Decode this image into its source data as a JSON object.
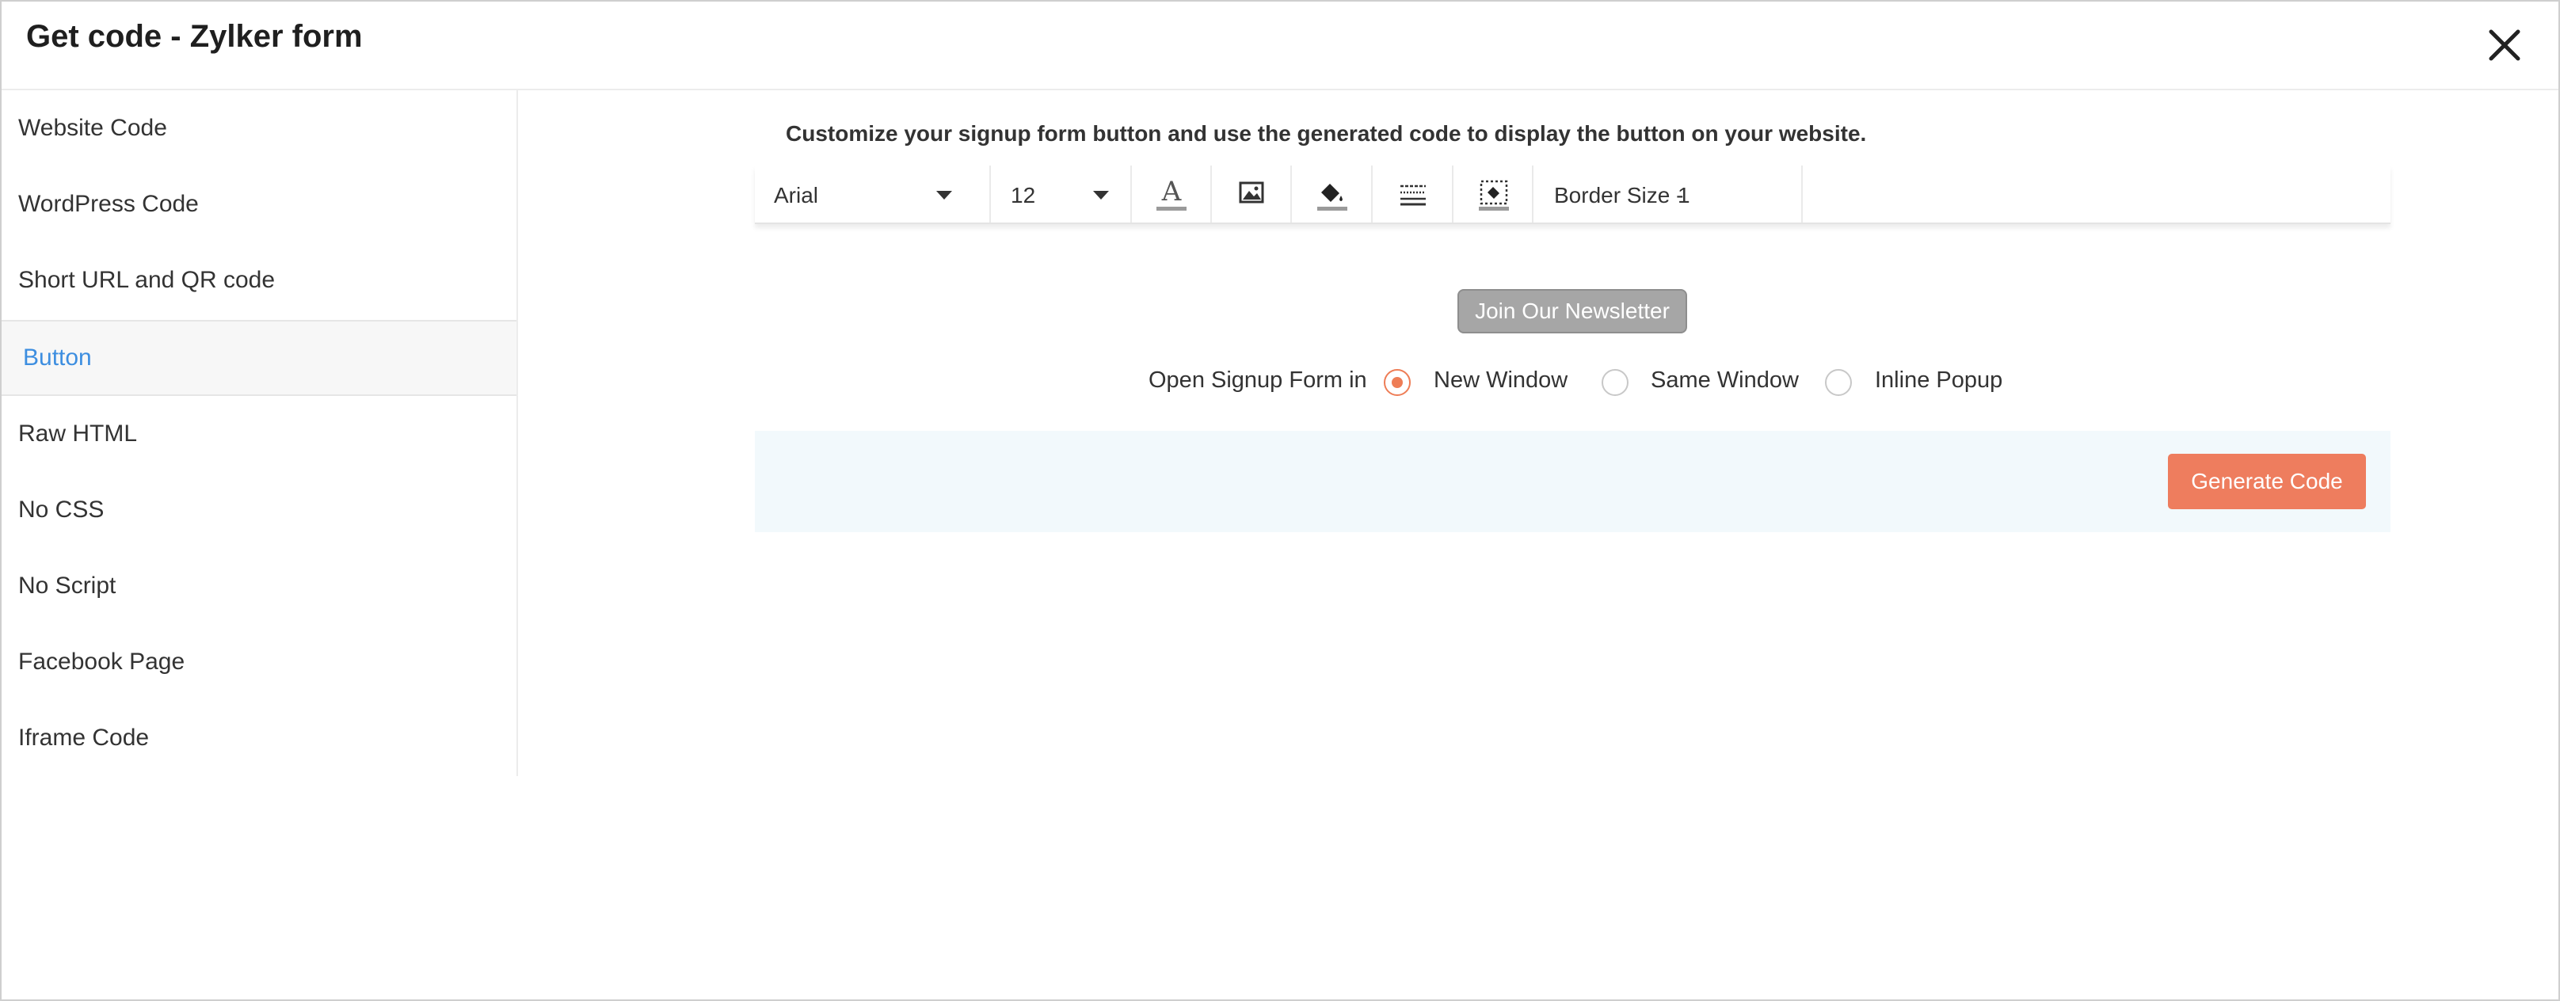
{
  "dialog": {
    "title": "Get code - Zylker form",
    "close_icon": "close-icon"
  },
  "sidebar": {
    "items": [
      {
        "label": "Website Code",
        "active": false
      },
      {
        "label": "WordPress Code",
        "active": false
      },
      {
        "label": "Short URL and QR code",
        "active": false
      },
      {
        "label": "Button",
        "active": true
      },
      {
        "label": "Raw HTML",
        "active": false
      },
      {
        "label": "No CSS",
        "active": false
      },
      {
        "label": "No Script",
        "active": false
      },
      {
        "label": "Facebook Page",
        "active": false
      },
      {
        "label": "Iframe Code",
        "active": false
      }
    ]
  },
  "main": {
    "description": "Customize your signup form button and use the generated code to display the button on your website.",
    "toolbar": {
      "font_family": "Arial",
      "font_size": "12",
      "icons": [
        "text-color-icon",
        "image-icon",
        "fill-color-icon",
        "border-style-icon",
        "border-color-icon"
      ],
      "border_label": "Border Size -",
      "border_value": "1"
    },
    "preview_button": {
      "label": "Join Our Newsletter"
    },
    "open_in": {
      "label": "Open Signup Form in",
      "options": [
        "New Window",
        "Same Window",
        "Inline Popup"
      ],
      "selected": "New Window"
    },
    "generate_button": {
      "label": "Generate Code"
    }
  },
  "colors": {
    "accent": "#ee7d5e",
    "active_link": "#3d8ee0",
    "preview_button_bg": "#a6a6a6",
    "footer_bg": "#f2f9fc"
  }
}
